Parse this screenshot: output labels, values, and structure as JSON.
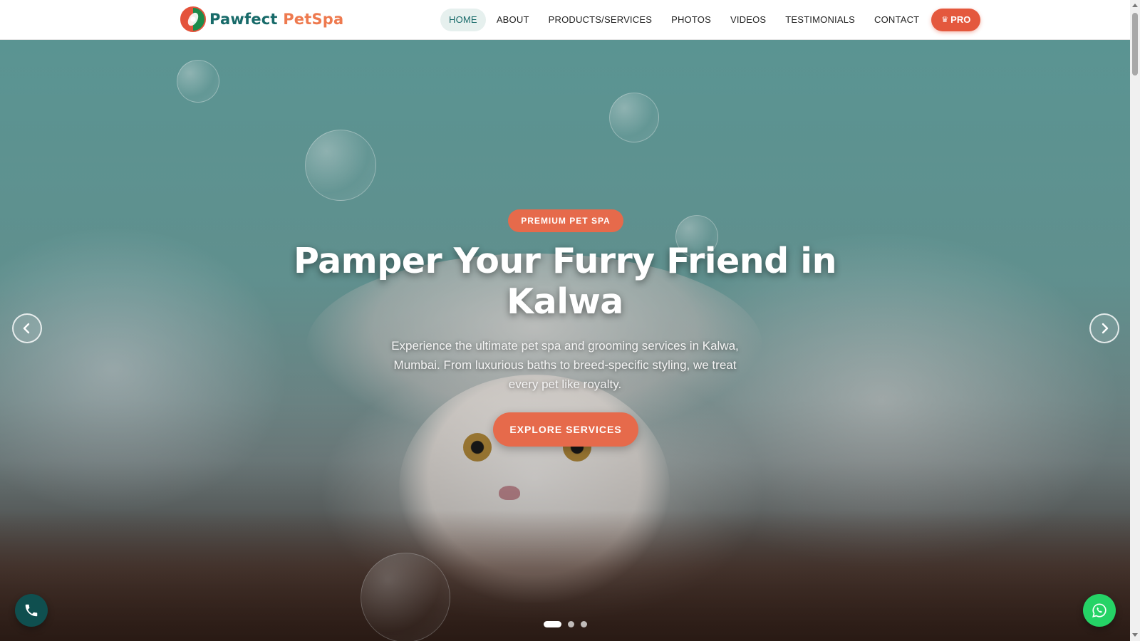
{
  "brand": {
    "name_part1": "Pawfect",
    "name_part2": "PetSpa",
    "icon": "paw-leaf-logo-icon"
  },
  "nav": {
    "items": [
      {
        "label": "HOME",
        "active": true
      },
      {
        "label": "ABOUT"
      },
      {
        "label": "PRODUCTS/SERVICES"
      },
      {
        "label": "PHOTOS"
      },
      {
        "label": "VIDEOS"
      },
      {
        "label": "TESTIMONIALS"
      },
      {
        "label": "CONTACT"
      }
    ],
    "pro_label": "PRO",
    "pro_icon": "crown-icon"
  },
  "hero": {
    "badge": "PREMIUM PET SPA",
    "title": "Pamper Your Furry Friend in Kalwa",
    "subtitle": "Experience the ultimate pet spa and grooming services in Kalwa, Mumbai. From luxurious baths to breed-specific styling, we treat every pet like royalty.",
    "cta_label": "EXPLORE SERVICES",
    "prev_icon": "chevron-left-icon",
    "next_icon": "chevron-right-icon",
    "slides_total": 3,
    "active_slide": 1
  },
  "floating": {
    "phone_icon": "phone-icon",
    "whatsapp_icon": "whatsapp-icon"
  },
  "colors": {
    "brand_teal": "#176a69",
    "brand_orange": "#ee7a4f",
    "accent": "#e66a4b",
    "whatsapp": "#25d366",
    "phone_fab": "#0f4f4f"
  }
}
